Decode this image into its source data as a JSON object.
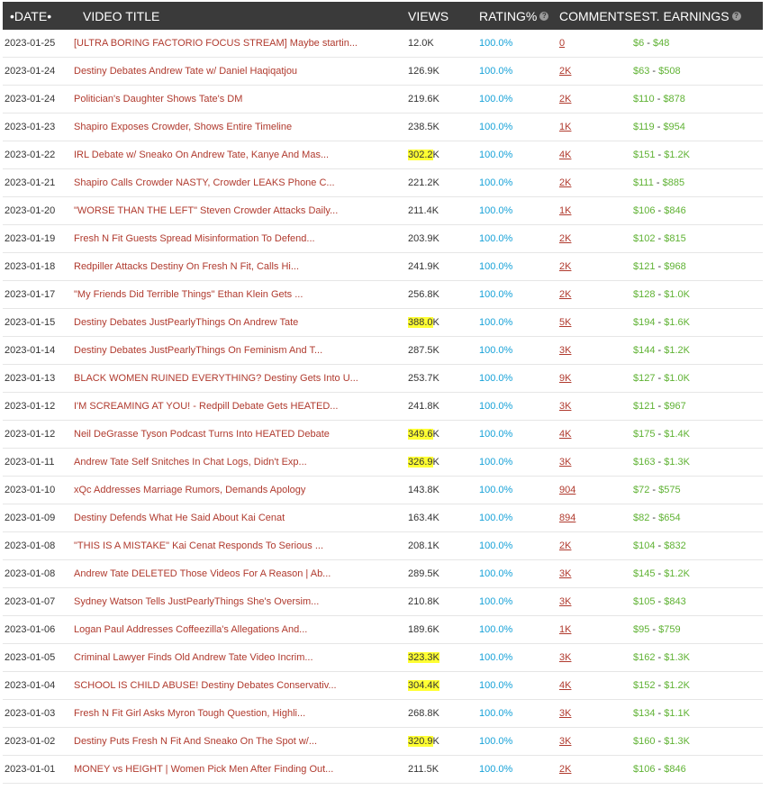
{
  "header": {
    "date": "•DATE•",
    "title": "VIDEO TITLE",
    "views": "VIEWS",
    "rating": "RATING%",
    "comments": "COMMENTS",
    "earnings": "EST. EARNINGS"
  },
  "colors": {
    "header_bg": "#3a3a3a",
    "title_link": "#b03a2e",
    "rating": "#17a2d8",
    "earnings": "#5fb233",
    "highlight": "#ffff33"
  },
  "rows": [
    {
      "date": "2023-01-25",
      "title": "[ULTRA BORING FACTORIO FOCUS STREAM] Maybe startin...",
      "views_hl": "",
      "views_rest": "12.0K",
      "rating": "100.0%",
      "comments": "0",
      "earn_low": "$6",
      "earn_sep": " - ",
      "earn_high": "$48"
    },
    {
      "date": "2023-01-24",
      "title": "Destiny Debates Andrew Tate w/ Daniel Haqiqatjou",
      "views_hl": "",
      "views_rest": "126.9K",
      "rating": "100.0%",
      "comments": "2K",
      "earn_low": "$63",
      "earn_sep": " - ",
      "earn_high": "$508"
    },
    {
      "date": "2023-01-24",
      "title": "Politician's Daughter Shows Tate's DM",
      "views_hl": "",
      "views_rest": "219.6K",
      "rating": "100.0%",
      "comments": "2K",
      "earn_low": "$110",
      "earn_sep": " - ",
      "earn_high": "$878"
    },
    {
      "date": "2023-01-23",
      "title": "Shapiro Exposes Crowder, Shows Entire Timeline",
      "views_hl": "",
      "views_rest": "238.5K",
      "rating": "100.0%",
      "comments": "1K",
      "earn_low": "$119",
      "earn_sep": " - ",
      "earn_high": "$954"
    },
    {
      "date": "2023-01-22",
      "title": "IRL Debate w/ Sneako On Andrew Tate, Kanye And Mas...",
      "views_hl": "302.2",
      "views_rest": "K",
      "rating": "100.0%",
      "comments": "4K",
      "earn_low": "$151",
      "earn_sep": " - ",
      "earn_high": "$1.2K"
    },
    {
      "date": "2023-01-21",
      "title": "Shapiro Calls Crowder NASTY, Crowder LEAKS Phone C...",
      "views_hl": "",
      "views_rest": "221.2K",
      "rating": "100.0%",
      "comments": "2K",
      "earn_low": "$111",
      "earn_sep": " - ",
      "earn_high": "$885"
    },
    {
      "date": "2023-01-20",
      "title": "\"WORSE THAN THE LEFT\" Steven Crowder Attacks Daily...",
      "views_hl": "",
      "views_rest": "211.4K",
      "rating": "100.0%",
      "comments": "1K",
      "earn_low": "$106",
      "earn_sep": " - ",
      "earn_high": "$846"
    },
    {
      "date": "2023-01-19",
      "title": "Fresh N Fit Guests Spread Misinformation To Defend...",
      "views_hl": "",
      "views_rest": "203.9K",
      "rating": "100.0%",
      "comments": "2K",
      "earn_low": "$102",
      "earn_sep": " - ",
      "earn_high": "$815"
    },
    {
      "date": "2023-01-18",
      "title": "Redpiller Attacks Destiny On Fresh N Fit, Calls Hi...",
      "views_hl": "",
      "views_rest": "241.9K",
      "rating": "100.0%",
      "comments": "2K",
      "earn_low": "$121",
      "earn_sep": " - ",
      "earn_high": "$968"
    },
    {
      "date": "2023-01-17",
      "title": "\"My Friends Did Terrible Things\" Ethan Klein Gets ...",
      "views_hl": "",
      "views_rest": "256.8K",
      "rating": "100.0%",
      "comments": "2K",
      "earn_low": "$128",
      "earn_sep": " - ",
      "earn_high": "$1.0K"
    },
    {
      "date": "2023-01-15",
      "title": "Destiny Debates JustPearlyThings On Andrew Tate",
      "views_hl": "388.0",
      "views_rest": "K",
      "rating": "100.0%",
      "comments": "5K",
      "earn_low": "$194",
      "earn_sep": " - ",
      "earn_high": "$1.6K"
    },
    {
      "date": "2023-01-14",
      "title": "Destiny Debates JustPearlyThings On Feminism And T...",
      "views_hl": "",
      "views_rest": "287.5K",
      "rating": "100.0%",
      "comments": "3K",
      "earn_low": "$144",
      "earn_sep": " - ",
      "earn_high": "$1.2K"
    },
    {
      "date": "2023-01-13",
      "title": "BLACK WOMEN RUINED EVERYTHING? Destiny Gets Into U...",
      "views_hl": "",
      "views_rest": "253.7K",
      "rating": "100.0%",
      "comments": "9K",
      "earn_low": "$127",
      "earn_sep": " - ",
      "earn_high": "$1.0K"
    },
    {
      "date": "2023-01-12",
      "title": "I'M SCREAMING AT YOU! - Redpill Debate Gets HEATED...",
      "views_hl": "",
      "views_rest": "241.8K",
      "rating": "100.0%",
      "comments": "3K",
      "earn_low": "$121",
      "earn_sep": " - ",
      "earn_high": "$967"
    },
    {
      "date": "2023-01-12",
      "title": "Neil DeGrasse Tyson Podcast Turns Into HEATED Debate",
      "views_hl": "349.6",
      "views_rest": "K",
      "rating": "100.0%",
      "comments": "4K",
      "earn_low": "$175",
      "earn_sep": " - ",
      "earn_high": "$1.4K"
    },
    {
      "date": "2023-01-11",
      "title": "Andrew Tate Self Snitches In Chat Logs, Didn't Exp...",
      "views_hl": "326.9",
      "views_rest": "K",
      "rating": "100.0%",
      "comments": "3K",
      "earn_low": "$163",
      "earn_sep": " - ",
      "earn_high": "$1.3K"
    },
    {
      "date": "2023-01-10",
      "title": "xQc Addresses Marriage Rumors, Demands Apology",
      "views_hl": "",
      "views_rest": "143.8K",
      "rating": "100.0%",
      "comments": "904",
      "earn_low": "$72",
      "earn_sep": " - ",
      "earn_high": "$575"
    },
    {
      "date": "2023-01-09",
      "title": "Destiny Defends What He Said About Kai Cenat",
      "views_hl": "",
      "views_rest": "163.4K",
      "rating": "100.0%",
      "comments": "894",
      "earn_low": "$82",
      "earn_sep": " - ",
      "earn_high": "$654"
    },
    {
      "date": "2023-01-08",
      "title": "\"THIS IS A MISTAKE\" Kai Cenat Responds To Serious ...",
      "views_hl": "",
      "views_rest": "208.1K",
      "rating": "100.0%",
      "comments": "2K",
      "earn_low": "$104",
      "earn_sep": " - ",
      "earn_high": "$832"
    },
    {
      "date": "2023-01-08",
      "title": "Andrew Tate DELETED Those Videos For A Reason | Ab...",
      "views_hl": "",
      "views_rest": "289.5K",
      "rating": "100.0%",
      "comments": "3K",
      "earn_low": "$145",
      "earn_sep": " - ",
      "earn_high": "$1.2K"
    },
    {
      "date": "2023-01-07",
      "title": "Sydney Watson Tells JustPearlyThings She's Oversim...",
      "views_hl": "",
      "views_rest": "210.8K",
      "rating": "100.0%",
      "comments": "3K",
      "earn_low": "$105",
      "earn_sep": " - ",
      "earn_high": "$843"
    },
    {
      "date": "2023-01-06",
      "title": "Logan Paul Addresses Coffeezilla's Allegations And...",
      "views_hl": "",
      "views_rest": "189.6K",
      "rating": "100.0%",
      "comments": "1K",
      "earn_low": "$95",
      "earn_sep": " - ",
      "earn_high": "$759"
    },
    {
      "date": "2023-01-05",
      "title": "Criminal Lawyer Finds Old Andrew Tate Video Incrim...",
      "views_hl": "323.3K",
      "views_rest": "",
      "rating": "100.0%",
      "comments": "3K",
      "earn_low": "$162",
      "earn_sep": " - ",
      "earn_high": "$1.3K"
    },
    {
      "date": "2023-01-04",
      "title": "SCHOOL IS CHILD ABUSE! Destiny Debates Conservativ...",
      "views_hl": "304.4K",
      "views_rest": "",
      "rating": "100.0%",
      "comments": "4K",
      "earn_low": "$152",
      "earn_sep": " - ",
      "earn_high": "$1.2K"
    },
    {
      "date": "2023-01-03",
      "title": "Fresh N Fit Girl Asks Myron Tough Question, Highli...",
      "views_hl": "",
      "views_rest": "268.8K",
      "rating": "100.0%",
      "comments": "3K",
      "earn_low": "$134",
      "earn_sep": " - ",
      "earn_high": "$1.1K"
    },
    {
      "date": "2023-01-02",
      "title": "Destiny Puts Fresh N Fit And Sneako On The Spot w/...",
      "views_hl": "320.9",
      "views_rest": "K",
      "rating": "100.0%",
      "comments": "3K",
      "earn_low": "$160",
      "earn_sep": " - ",
      "earn_high": "$1.3K"
    },
    {
      "date": "2023-01-01",
      "title": "MONEY vs HEIGHT | Women Pick Men After Finding Out...",
      "views_hl": "",
      "views_rest": "211.5K",
      "rating": "100.0%",
      "comments": "2K",
      "earn_low": "$106",
      "earn_sep": " - ",
      "earn_high": "$846"
    }
  ]
}
